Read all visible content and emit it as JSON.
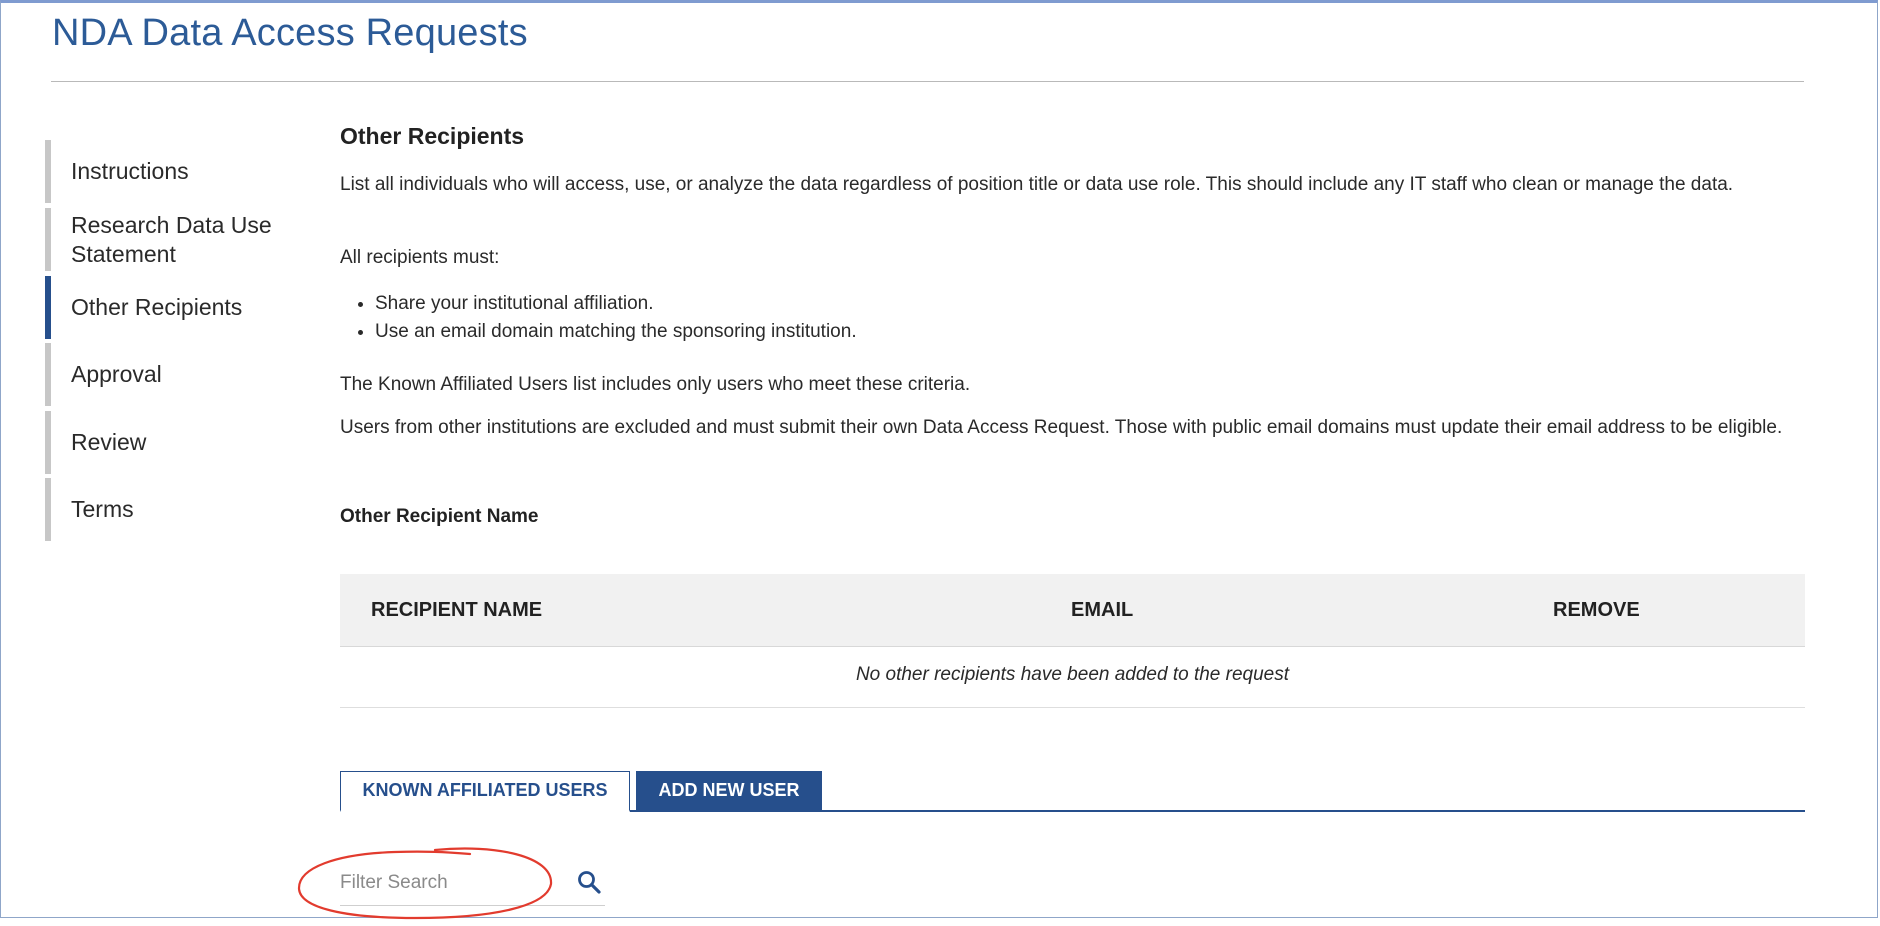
{
  "page": {
    "title": "NDA Data Access Requests"
  },
  "sidebar": {
    "items": [
      {
        "label": "Instructions",
        "active": false
      },
      {
        "label": "Research Data Use Statement",
        "active": false
      },
      {
        "label": "Other Recipients",
        "active": true
      },
      {
        "label": "Approval",
        "active": false
      },
      {
        "label": "Review",
        "active": false
      },
      {
        "label": "Terms",
        "active": false
      }
    ]
  },
  "main": {
    "heading": "Other Recipients",
    "intro": "List all individuals who will access, use, or analyze the data regardless of position title or data use role. This should include any IT staff who clean or manage the data.",
    "must_label": "All recipients must:",
    "requirements": [
      "Share your institutional affiliation.",
      "Use an email domain matching the sponsoring institution."
    ],
    "known_note": "The Known Affiliated Users list includes only users who meet these criteria.",
    "excluded_note": "Users from other institutions are excluded and must submit their own Data Access Request. Those with public email domains must update their email address to be eligible.",
    "field_label": "Other Recipient Name",
    "table": {
      "columns": [
        "RECIPIENT NAME",
        "EMAIL",
        "REMOVE"
      ],
      "empty_message": "No other recipients have been added to the request"
    },
    "tabs": [
      {
        "label": "KNOWN AFFILIATED USERS",
        "active": true
      },
      {
        "label": "ADD NEW USER",
        "active": false
      }
    ],
    "search": {
      "placeholder": "Filter Search",
      "value": "",
      "icon": "search-icon"
    }
  },
  "colors": {
    "brand": "#2c5b97",
    "accent": "#264f8c",
    "annotation": "#e23b2e"
  }
}
